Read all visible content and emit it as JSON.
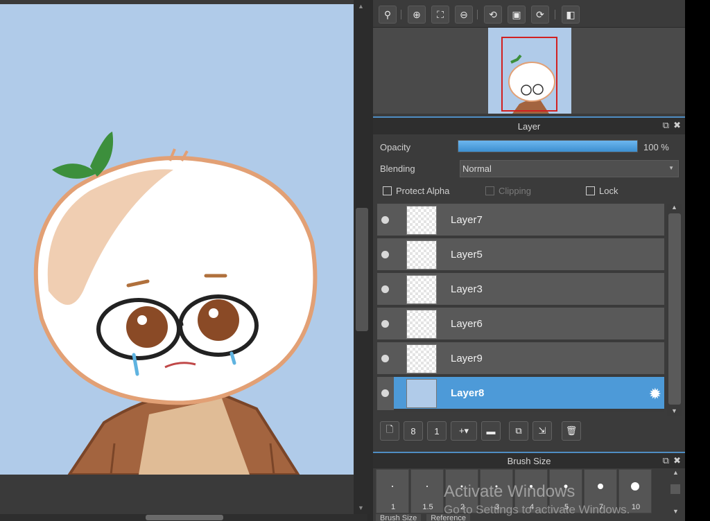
{
  "layer_panel": {
    "title": "Layer",
    "opacity_label": "Opacity",
    "opacity_value": "100 %",
    "opacity_fraction": 1.0,
    "blending_label": "Blending",
    "blending_value": "Normal",
    "protect_alpha": "Protect Alpha",
    "clipping": "Clipping",
    "lock": "Lock",
    "layers": [
      {
        "name": "Layer7",
        "selected": false
      },
      {
        "name": "Layer5",
        "selected": false
      },
      {
        "name": "Layer3",
        "selected": false
      },
      {
        "name": "Layer6",
        "selected": false
      },
      {
        "name": "Layer9",
        "selected": false
      },
      {
        "name": "Layer8",
        "selected": true
      }
    ]
  },
  "brush_panel": {
    "title": "Brush Size",
    "sizes": [
      "1",
      "1.5",
      "2",
      "3",
      "4",
      "5",
      "7",
      "10"
    ]
  },
  "tabs": [
    "Brush Size",
    "Reference"
  ],
  "watermark": {
    "title": "Activate Windows",
    "subtitle": "Go to Settings to activate Windows."
  },
  "colors": {
    "canvas_bg": "#b0cbe9",
    "accent": "#4d9ad8",
    "panel_bg": "#3b3b3b"
  }
}
